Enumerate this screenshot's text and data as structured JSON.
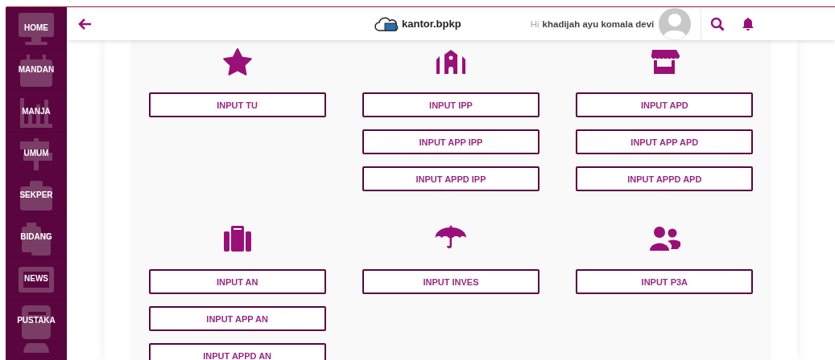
{
  "sidebar": {
    "items": [
      {
        "label": "HOME"
      },
      {
        "label": "MANDAN"
      },
      {
        "label": "MANJA"
      },
      {
        "label": "UMUM"
      },
      {
        "label": "SEKPER"
      },
      {
        "label": "BIDANG"
      },
      {
        "label": "NEWS"
      },
      {
        "label": "PUSTAKA"
      }
    ]
  },
  "header": {
    "logo": "kantor.bpkp",
    "greeting": "Hi",
    "user": "khadijah ayu komala devi"
  },
  "sections": [
    {
      "groups": [
        {
          "buttons": [
            "INPUT TU"
          ]
        },
        {
          "buttons": [
            "INPUT IPP",
            "INPUT APP IPP",
            "INPUT APPD IPP"
          ]
        },
        {
          "buttons": [
            "INPUT APD",
            "INPUT APP APD",
            "INPUT APPD APD"
          ]
        }
      ]
    },
    {
      "groups": [
        {
          "buttons": [
            "INPUT AN",
            "INPUT APP AN",
            "INPUT APPD AN"
          ]
        },
        {
          "buttons": [
            "INPUT INVES"
          ]
        },
        {
          "buttons": [
            "INPUT P3A"
          ]
        }
      ]
    }
  ]
}
